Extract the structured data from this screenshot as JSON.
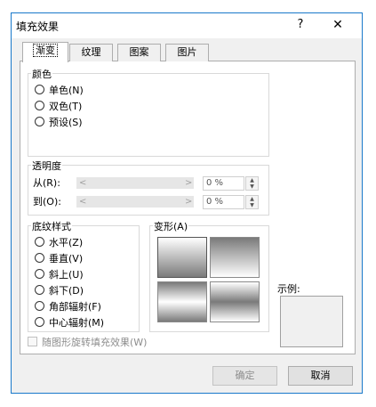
{
  "window": {
    "title": "填充效果",
    "help_glyph": "?",
    "close_glyph": "✕"
  },
  "tabs": [
    "渐变",
    "纹理",
    "图案",
    "图片"
  ],
  "color": {
    "legend": "颜色",
    "options": [
      "单色(N)",
      "双色(T)",
      "预设(S)"
    ]
  },
  "transparency": {
    "legend": "透明度",
    "from_label": "从(R):",
    "to_label": "到(O):",
    "from_value": "0 %",
    "to_value": "0 %"
  },
  "shading": {
    "legend": "底纹样式",
    "options": [
      "水平(Z)",
      "垂直(V)",
      "斜上(U)",
      "斜下(D)",
      "角部辐射(F)",
      "中心辐射(M)"
    ]
  },
  "variants": {
    "legend": "变形(A)"
  },
  "sample": {
    "label": "示例:"
  },
  "rotate": {
    "label": "随图形旋转填充效果(W)"
  },
  "buttons": {
    "ok": "确定",
    "cancel": "取消"
  },
  "colors": {
    "frame": "#1979ca",
    "dialog_bg": "#f0f0f0",
    "panel_bg": "#ffffff",
    "disabled_text": "#8d8d8d"
  }
}
